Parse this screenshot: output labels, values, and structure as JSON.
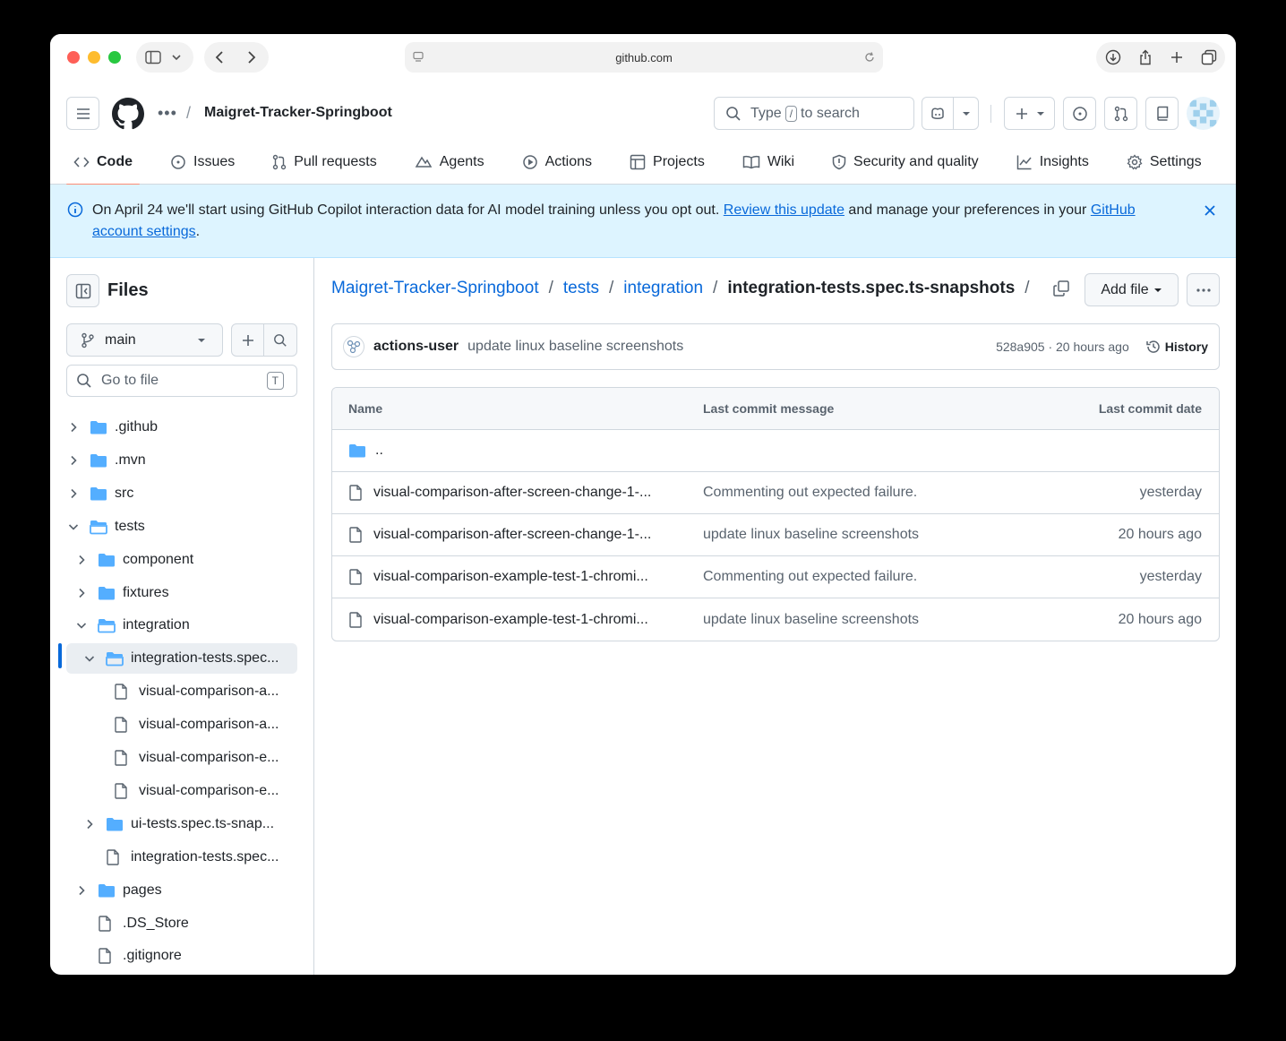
{
  "browser": {
    "url": "github.com"
  },
  "header": {
    "repo_name": "Maigret-Tracker-Springboot",
    "search_placeholder_pre": "Type",
    "search_key": "/",
    "search_placeholder_post": "to search"
  },
  "tabs": [
    {
      "label": "Code",
      "icon": "code-icon"
    },
    {
      "label": "Issues",
      "icon": "issue-icon"
    },
    {
      "label": "Pull requests",
      "icon": "pull-request-icon"
    },
    {
      "label": "Agents",
      "icon": "agents-icon"
    },
    {
      "label": "Actions",
      "icon": "play-icon"
    },
    {
      "label": "Projects",
      "icon": "table-icon"
    },
    {
      "label": "Wiki",
      "icon": "book-icon"
    },
    {
      "label": "Security and quality",
      "icon": "shield-icon"
    },
    {
      "label": "Insights",
      "icon": "graph-icon"
    },
    {
      "label": "Settings",
      "icon": "gear-icon"
    }
  ],
  "banner": {
    "text_1": "On April 24 we'll start using GitHub Copilot interaction data for AI model training unless you opt out.",
    "link_1": "Review this update",
    "text_2": "and manage your preferences in your",
    "link_2": "GitHub account settings",
    "text_3": "."
  },
  "sidebar": {
    "title": "Files",
    "branch": "main",
    "go_to_file_placeholder": "Go to file",
    "go_to_file_key": "T",
    "tree": [
      {
        "label": ".github",
        "type": "folder",
        "expanded": false,
        "depth": 0
      },
      {
        "label": ".mvn",
        "type": "folder",
        "expanded": false,
        "depth": 0
      },
      {
        "label": "src",
        "type": "folder",
        "expanded": false,
        "depth": 0
      },
      {
        "label": "tests",
        "type": "folder",
        "expanded": true,
        "depth": 0
      },
      {
        "label": "component",
        "type": "folder",
        "expanded": false,
        "depth": 1
      },
      {
        "label": "fixtures",
        "type": "folder",
        "expanded": false,
        "depth": 1
      },
      {
        "label": "integration",
        "type": "folder",
        "expanded": true,
        "depth": 1
      },
      {
        "label": "integration-tests.spec...",
        "type": "folder",
        "expanded": true,
        "depth": 2,
        "selected": true
      },
      {
        "label": "visual-comparison-a...",
        "type": "file",
        "depth": 3
      },
      {
        "label": "visual-comparison-a...",
        "type": "file",
        "depth": 3
      },
      {
        "label": "visual-comparison-e...",
        "type": "file",
        "depth": 3
      },
      {
        "label": "visual-comparison-e...",
        "type": "file",
        "depth": 3
      },
      {
        "label": "ui-tests.spec.ts-snap...",
        "type": "folder",
        "expanded": false,
        "depth": 2
      },
      {
        "label": "integration-tests.spec...",
        "type": "file",
        "depth": 2
      },
      {
        "label": "pages",
        "type": "folder",
        "expanded": false,
        "depth": 1
      },
      {
        "label": ".DS_Store",
        "type": "file",
        "depth": 1
      },
      {
        "label": ".gitignore",
        "type": "file",
        "depth": 1
      }
    ]
  },
  "main": {
    "breadcrumb": [
      "Maigret-Tracker-Springboot",
      "tests",
      "integration"
    ],
    "current_dir": "integration-tests.spec.ts-snapshots",
    "add_file_label": "Add file",
    "commit": {
      "author": "actions-user",
      "message": "update linux baseline screenshots",
      "hash_time": "528a905 · 20 hours ago",
      "history_label": "History"
    },
    "table": {
      "headers": {
        "name": "Name",
        "message": "Last commit message",
        "date": "Last commit date"
      },
      "parent_label": "..",
      "rows": [
        {
          "name": "visual-comparison-after-screen-change-1-...",
          "message": "Commenting out expected failure.",
          "date": "yesterday"
        },
        {
          "name": "visual-comparison-after-screen-change-1-...",
          "message": "update linux baseline screenshots",
          "date": "20 hours ago"
        },
        {
          "name": "visual-comparison-example-test-1-chromi...",
          "message": "Commenting out expected failure.",
          "date": "yesterday"
        },
        {
          "name": "visual-comparison-example-test-1-chromi...",
          "message": "update linux baseline screenshots",
          "date": "20 hours ago"
        }
      ]
    }
  },
  "colors": {
    "link": "#0969da",
    "folder": "#54aeff",
    "active_tab_underline": "#fd8c73",
    "banner_bg": "#ddf4ff"
  }
}
